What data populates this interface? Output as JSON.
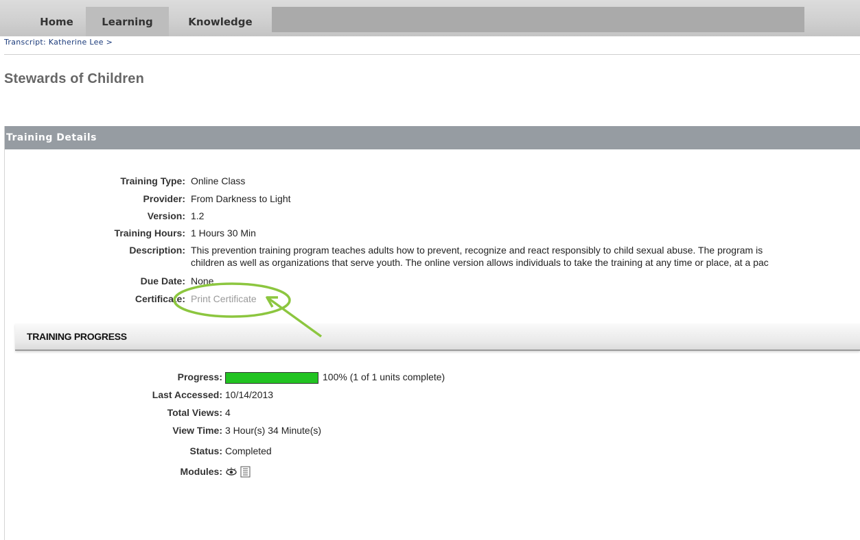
{
  "nav": {
    "tabs": [
      {
        "label": "Home"
      },
      {
        "label": "Learning"
      },
      {
        "label": "Knowledge"
      }
    ]
  },
  "breadcrumb": "Transcript: Katherine Lee  >",
  "page_title": "Stewards of Children",
  "details": {
    "header": "Training Details",
    "rows": [
      {
        "label": "Training Type:",
        "value": "Online Class"
      },
      {
        "label": "Provider:",
        "value": "From Darkness to Light"
      },
      {
        "label": "Version:",
        "value": "1.2"
      },
      {
        "label": "Training Hours:",
        "value": "1 Hours 30 Min"
      },
      {
        "label": "Description:",
        "value": "This prevention training program teaches adults how to prevent, recognize and react responsibly to child sexual abuse. The program is",
        "value2": "children as well as organizations that serve youth. The online version allows individuals to take the training at any time or place, at a pac"
      },
      {
        "label": "Due Date:",
        "value": "None"
      },
      {
        "label": "Certificate:",
        "value": "Print Certificate"
      }
    ]
  },
  "progress_section": {
    "title": "TRAINING PROGRESS",
    "progress": {
      "label": "Progress:",
      "percent": 100,
      "text": "100% (1 of 1 units complete)"
    },
    "rows": [
      {
        "label": "Last Accessed:",
        "value": "10/14/2013"
      },
      {
        "label": "Total Views:",
        "value": "4"
      },
      {
        "label": "View Time:",
        "value": "3 Hour(s) 34 Minute(s)"
      },
      {
        "label": "Status:",
        "value": "Completed"
      },
      {
        "label": "Modules:",
        "icons": [
          "eye-icon",
          "document-list-icon"
        ]
      }
    ]
  },
  "colors": {
    "progress_fill": "#22c322",
    "annotation": "#8cc63f",
    "header_bg": "#969ca2"
  }
}
